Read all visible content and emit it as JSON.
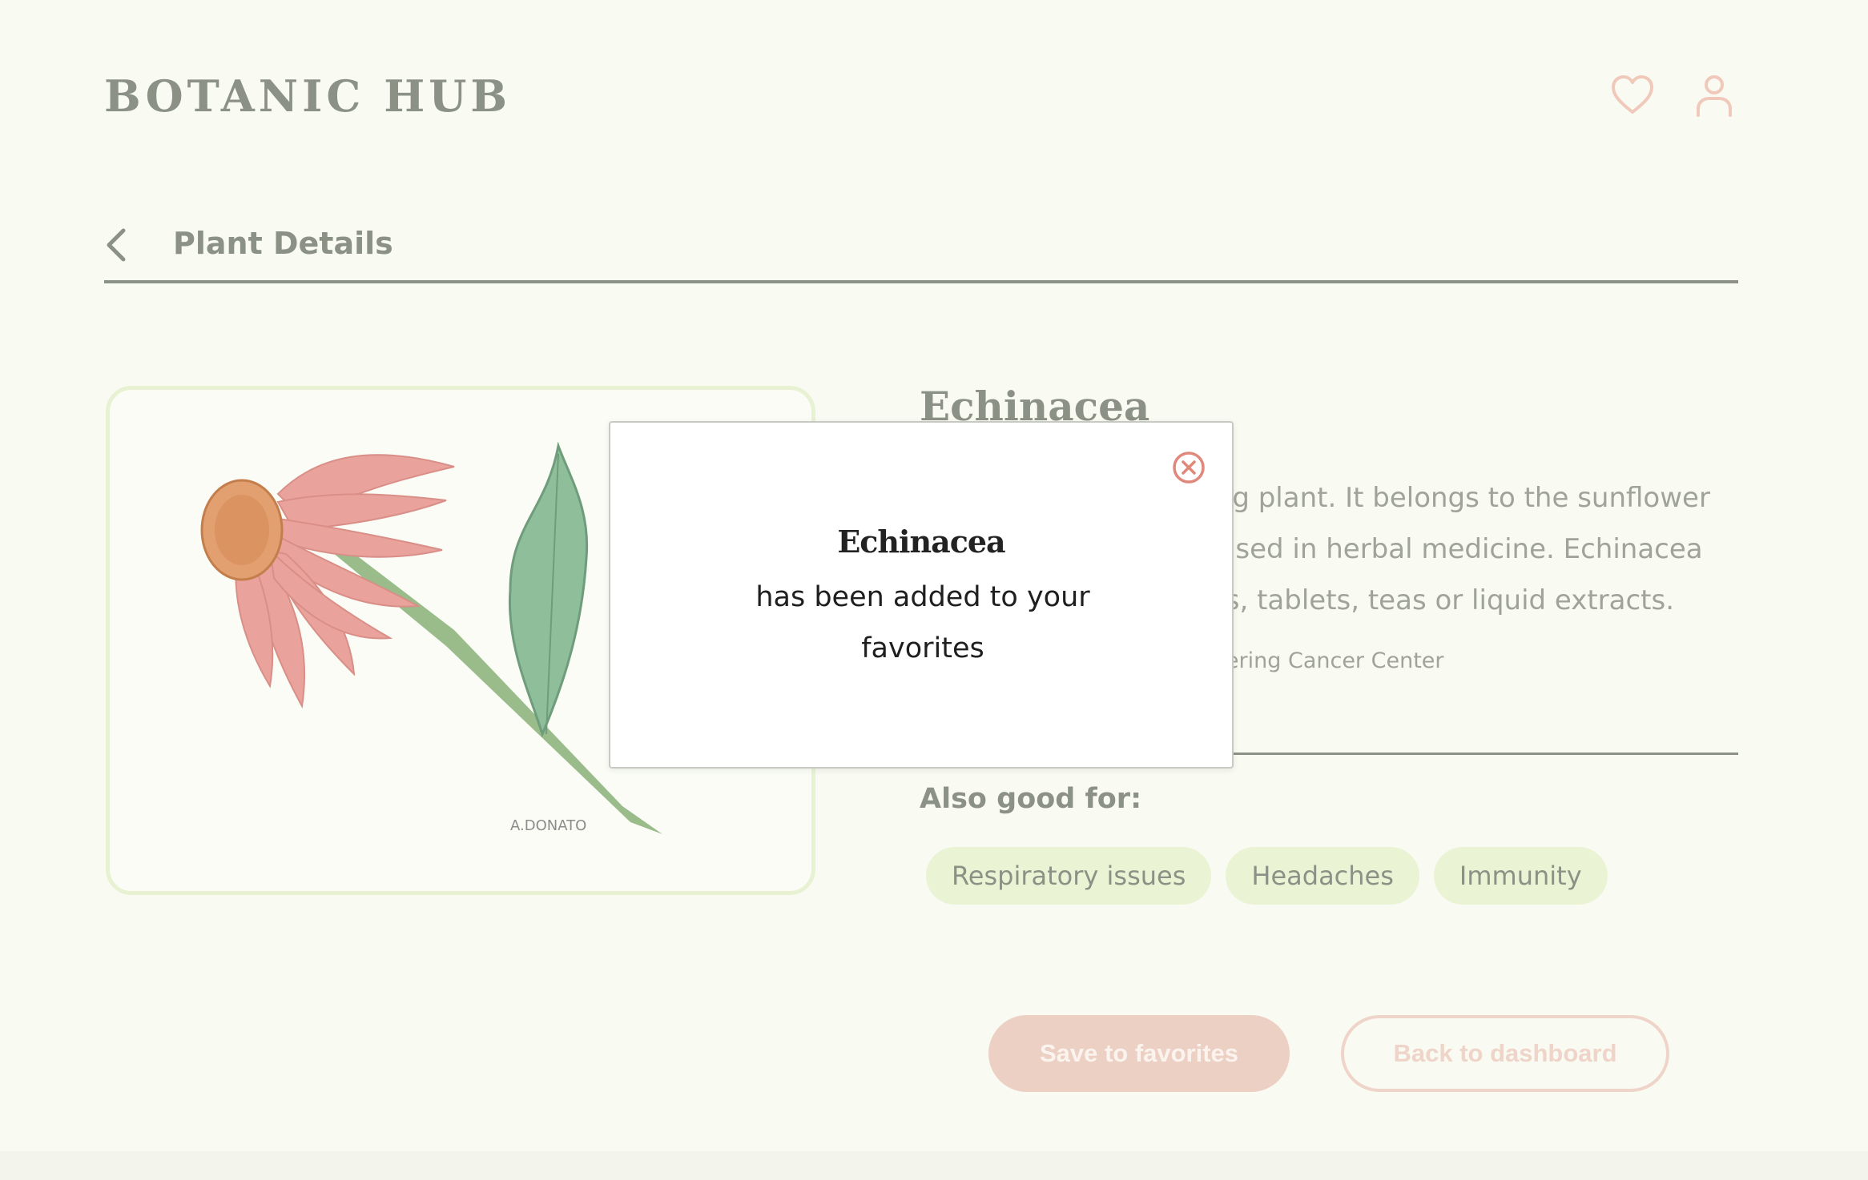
{
  "header": {
    "brand": "BOTANIC HUB",
    "icons": [
      "heart-icon",
      "user-icon"
    ]
  },
  "subheader": {
    "back_icon": "chevron-left-icon",
    "title": "Plant Details"
  },
  "plant": {
    "name": "Echinacea",
    "description": "Echinacea is a flowering plant. It belongs to the sunflower family. It’s commonly used in herbal medicine. Echinacea also comes as capsules, tablets, teas or liquid extracts.",
    "source": "Source: Memorial Sloan Kettering Cancer Center",
    "image_signature": "A.DONATO"
  },
  "also_good_for": {
    "label": "Also good for:",
    "tags": [
      "Respiratory issues",
      "Headaches",
      "Immunity"
    ]
  },
  "actions": {
    "save": "Save to favorites",
    "back": "Back to dashboard"
  },
  "modal": {
    "title": "Echinacea",
    "message": "has been added to your favorites",
    "close_icon": "close-circle-icon"
  },
  "colors": {
    "background": "#f9faf2",
    "muted_text": "#8c9185",
    "accent": "#e0887a",
    "tag_bg": "#eaf3d4"
  }
}
